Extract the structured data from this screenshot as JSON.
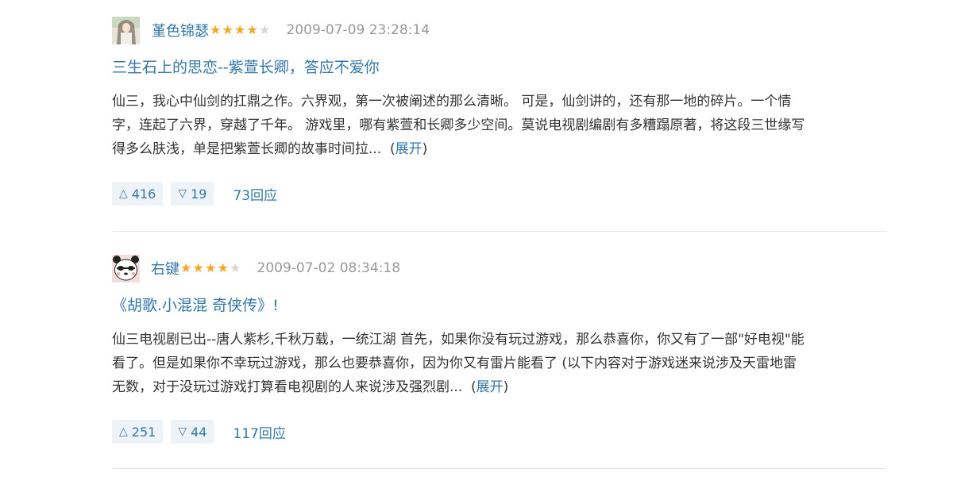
{
  "reviews": [
    {
      "username": "堇色锦瑟",
      "rating": 4,
      "timestamp": "2009-07-09 23:28:14",
      "title": "三生石上的思恋--紫萱长卿，答应不爱你",
      "lines": [
        "仙三，我心中仙剑的扛鼎之作。六界观，第一次被阐述的那么清晰。 可是，仙剑讲的，还有那一地的碎片。一个情",
        "字，连起了六界，穿越了千年。 游戏里，哪有紫萱和长卿多少空间。莫说电视剧编剧有多糟蹋原著，将这段三世缘写",
        "得多么肤浅，单是把紫萱长卿的故事时间拉..."
      ],
      "expand_open": "(",
      "expand": "展开",
      "expand_close": ")",
      "up_icon": "△",
      "up_count": "416",
      "down_icon": "▽",
      "down_count": "19",
      "replies": "73回应"
    },
    {
      "username": "右键",
      "rating": 4,
      "timestamp": "2009-07-02 08:34:18",
      "title": "《胡歌.小混混 奇侠传》!",
      "lines": [
        "仙三电视剧已出--唐人紫杉,千秋万载，一统江湖 首先，如果你没有玩过游戏，那么恭喜你，你又有了一部\"好电视\"能",
        "看了。但是如果你不幸玩过游戏，那么也要恭喜你，因为你又有雷片能看了  (以下内容对于游戏迷来说涉及天雷地雷",
        "无数，对于没玩过游戏打算看电视剧的人来说涉及强烈剧..."
      ],
      "expand_open": "(",
      "expand": "展开",
      "expand_close": ")",
      "up_icon": "△",
      "up_count": "251",
      "down_icon": "▽",
      "down_count": "44",
      "replies": "117回应"
    }
  ],
  "colors": {
    "link": "#3377aa",
    "star": "#f5a623",
    "vote_bg": "#eef3f8"
  }
}
